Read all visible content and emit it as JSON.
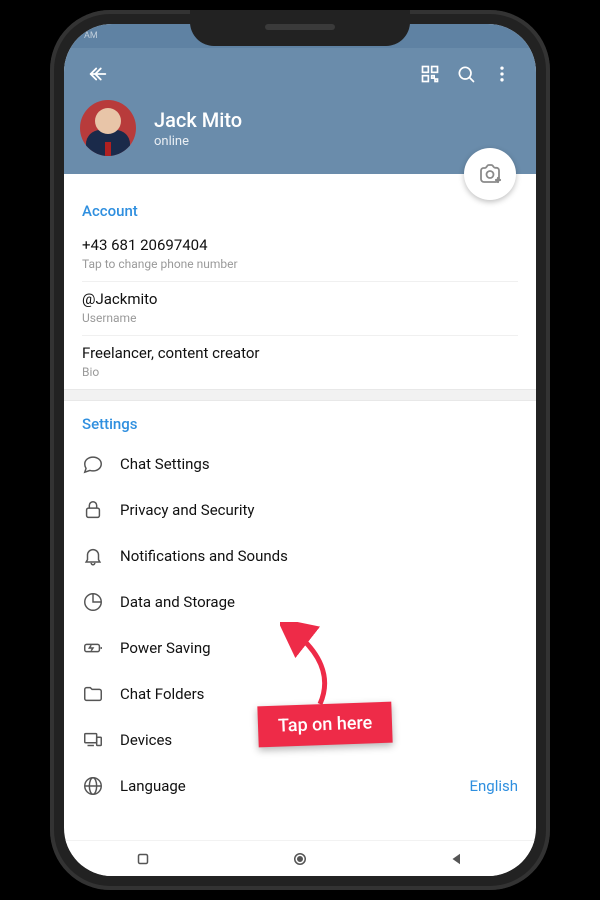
{
  "statusbar": {
    "left": "AM",
    "right": ""
  },
  "header": {
    "name": "Jack Mito",
    "status": "online"
  },
  "account": {
    "section_title": "Account",
    "phone": {
      "value": "+43 681 20697404",
      "sub": "Tap to change phone number"
    },
    "username": {
      "value": "@Jackmito",
      "sub": "Username"
    },
    "bio": {
      "value": "Freelancer, content creator",
      "sub": "Bio"
    }
  },
  "settings": {
    "section_title": "Settings",
    "items": [
      {
        "label": "Chat Settings",
        "icon": "chat-bubble-icon"
      },
      {
        "label": "Privacy and Security",
        "icon": "lock-icon"
      },
      {
        "label": "Notifications and Sounds",
        "icon": "bell-icon"
      },
      {
        "label": "Data and Storage",
        "icon": "pie-icon"
      },
      {
        "label": "Power Saving",
        "icon": "battery-icon"
      },
      {
        "label": "Chat Folders",
        "icon": "folder-icon"
      },
      {
        "label": "Devices",
        "icon": "devices-icon"
      },
      {
        "label": "Language",
        "icon": "globe-icon",
        "value": "English"
      }
    ]
  },
  "annotation": {
    "text": "Tap on here"
  }
}
